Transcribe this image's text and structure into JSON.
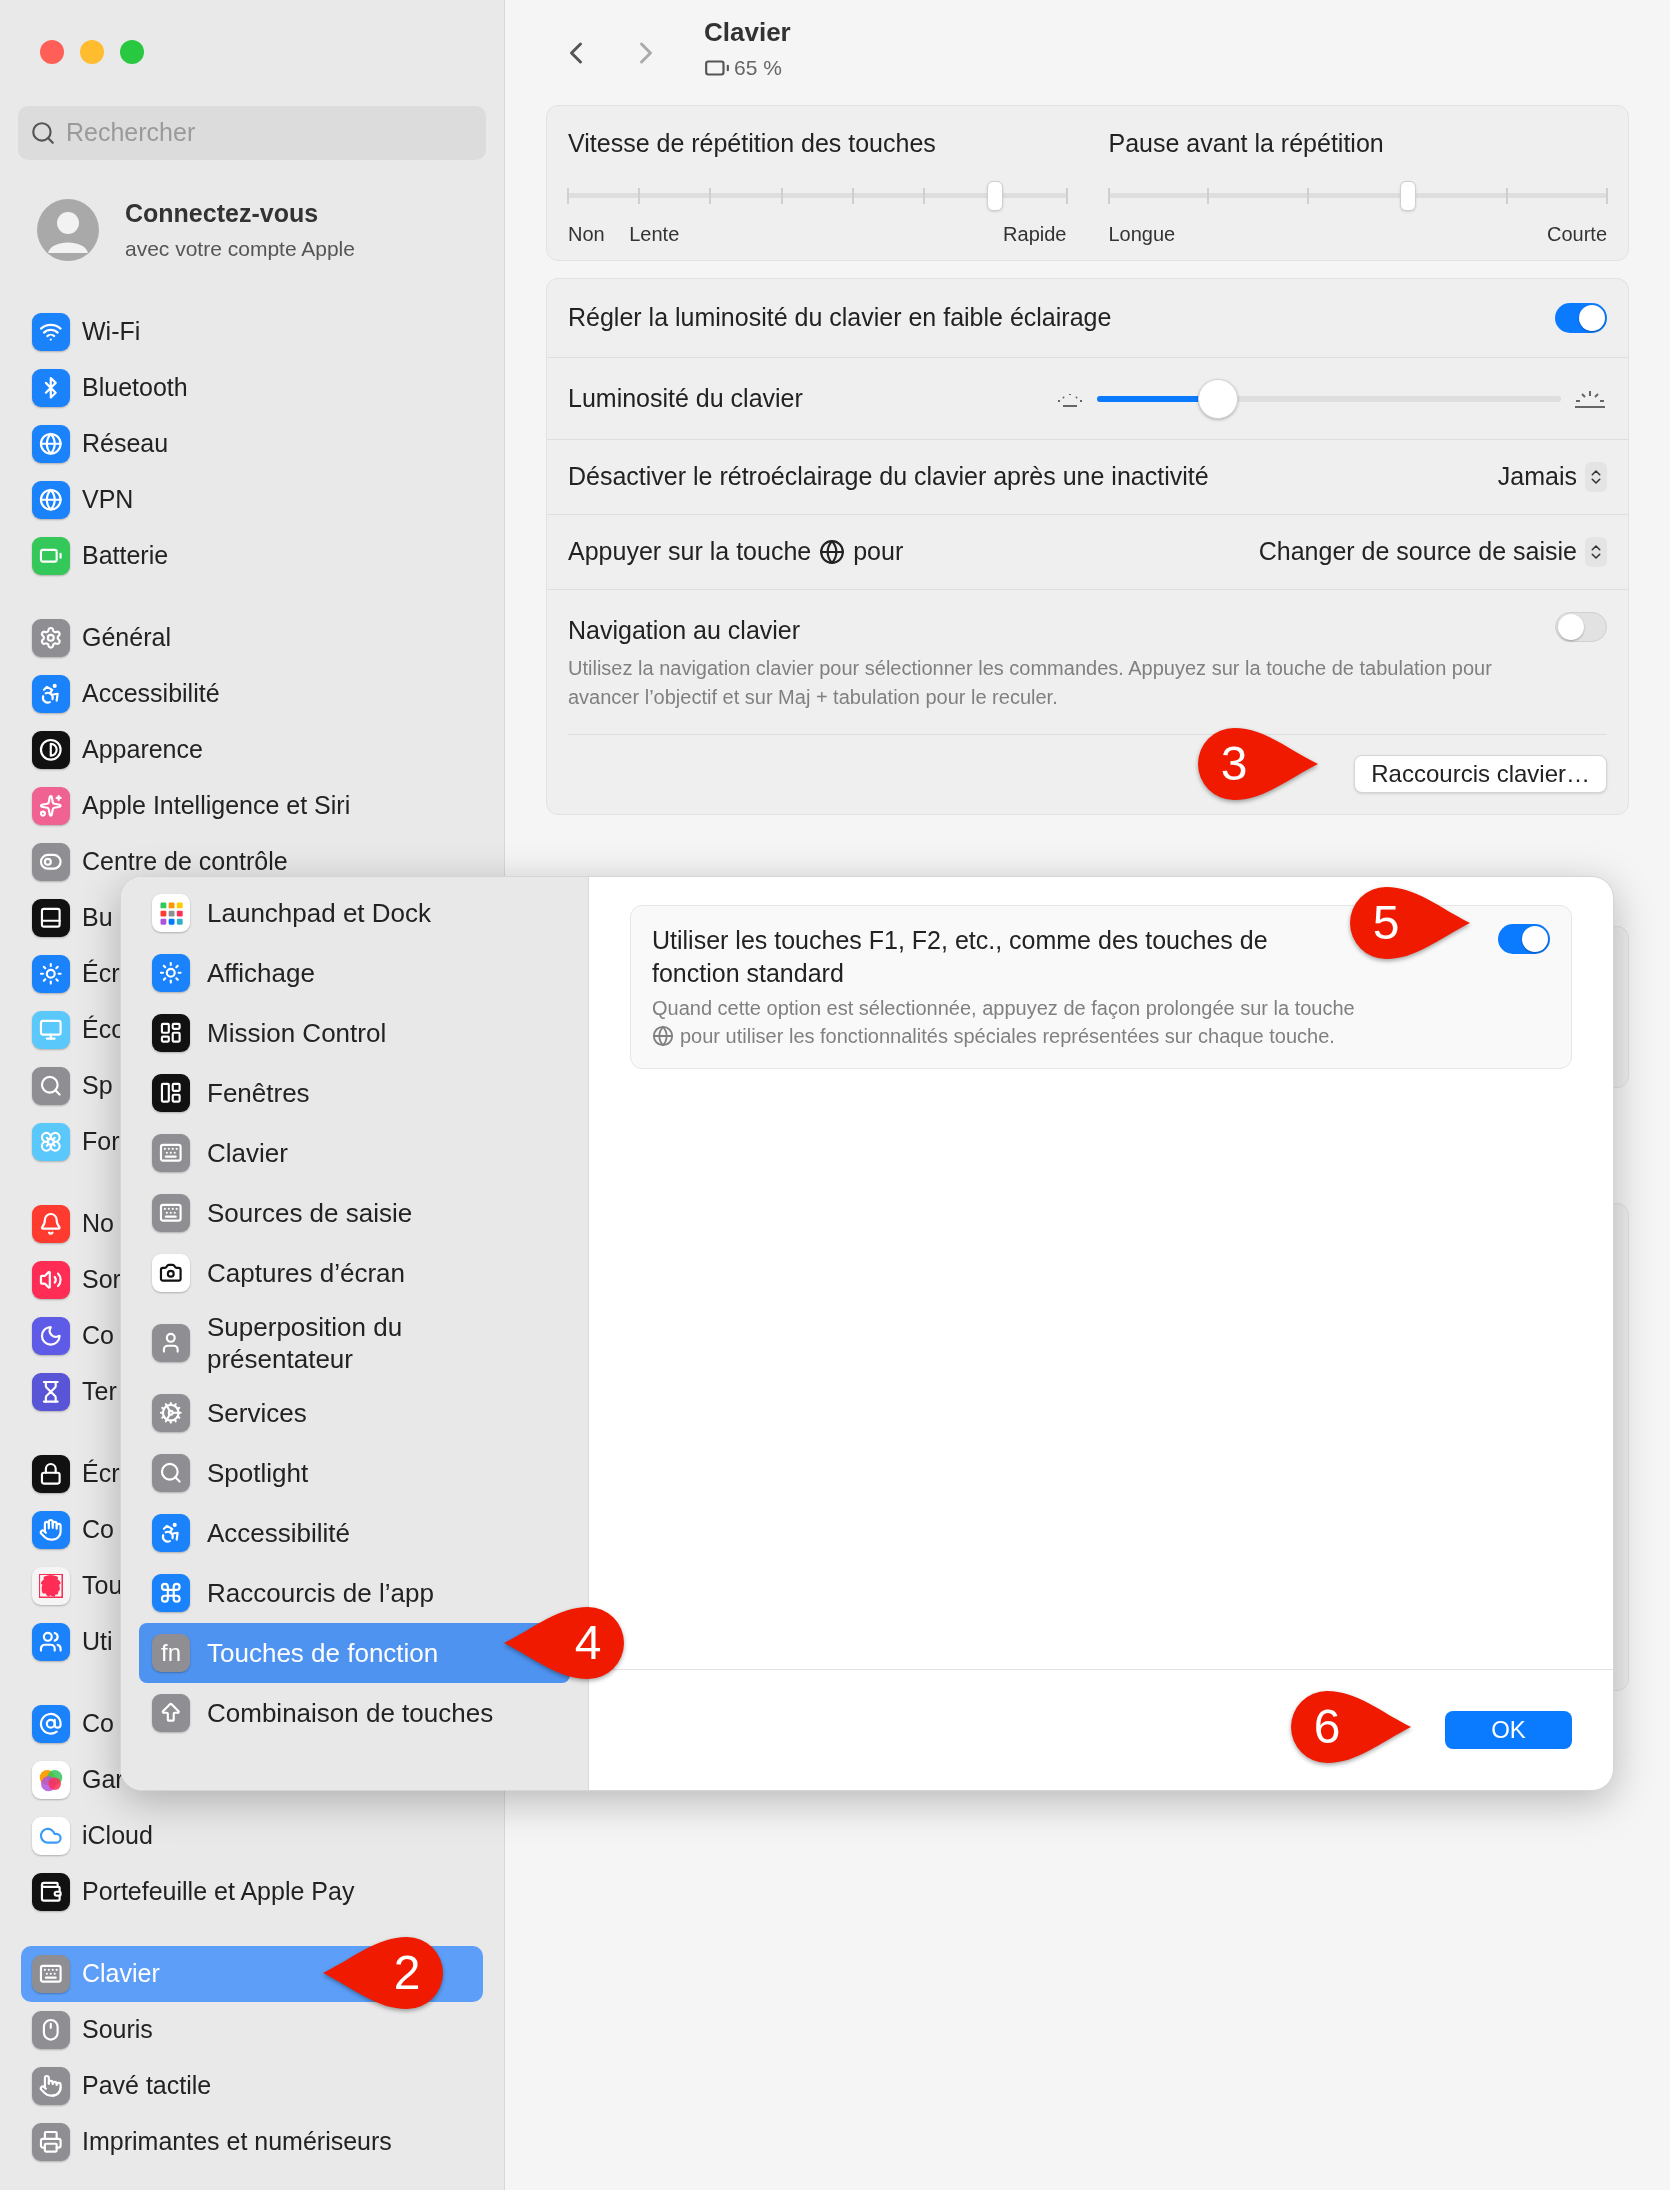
{
  "sidebar": {
    "search": {
      "placeholder": "Rechercher"
    },
    "account": {
      "title": "Connectez-vous",
      "subtitle": "avec votre compte Apple"
    },
    "groups": [
      {
        "items": [
          {
            "label": "Wi-Fi",
            "selected": false
          },
          {
            "label": "Bluetooth",
            "selected": false
          },
          {
            "label": "Réseau",
            "selected": false
          },
          {
            "label": "VPN",
            "selected": false
          },
          {
            "label": "Batterie",
            "selected": false
          }
        ]
      },
      {
        "items": [
          {
            "label": "Général",
            "selected": false
          },
          {
            "label": "Accessibilité",
            "selected": false
          },
          {
            "label": "Apparence",
            "selected": false
          },
          {
            "label": "Apple Intelligence et Siri",
            "selected": false
          },
          {
            "label": "Centre de contrôle",
            "selected": false
          },
          {
            "label": "Bu",
            "selected": false
          },
          {
            "label": "Écr",
            "selected": false
          },
          {
            "label": "Éco",
            "selected": false
          },
          {
            "label": "Sp",
            "selected": false
          },
          {
            "label": "For",
            "selected": false
          }
        ]
      },
      {
        "items": [
          {
            "label": "No",
            "selected": false
          },
          {
            "label": "Sor",
            "selected": false
          },
          {
            "label": "Co",
            "selected": false
          },
          {
            "label": "Ter",
            "selected": false
          }
        ]
      },
      {
        "items": [
          {
            "label": "Écr",
            "selected": false
          },
          {
            "label": "Co",
            "selected": false
          },
          {
            "label": "Tou",
            "selected": false
          },
          {
            "label": "Uti",
            "selected": false
          }
        ]
      },
      {
        "items": [
          {
            "label": "Co",
            "selected": false
          },
          {
            "label": "Gar",
            "selected": false
          },
          {
            "label": "iCloud",
            "selected": false
          },
          {
            "label": "Portefeuille et Apple Pay",
            "selected": false
          }
        ]
      },
      {
        "items": [
          {
            "label": "Clavier",
            "selected": true
          },
          {
            "label": "Souris",
            "selected": false
          },
          {
            "label": "Pavé tactile",
            "selected": false
          },
          {
            "label": "Imprimantes et numériseurs",
            "selected": false
          }
        ]
      }
    ]
  },
  "header": {
    "title": "Clavier",
    "battery": "65 %"
  },
  "repeat_card": {
    "sliders": [
      {
        "title": "Vitesse de répétition des touches",
        "level": 0.857,
        "labels": [
          "Non",
          "Lente",
          "Rapide"
        ]
      },
      {
        "title": "Pause avant la répétition",
        "level": 0.6,
        "labels": [
          "Longue",
          "Courte"
        ]
      }
    ]
  },
  "settings_card": {
    "rows": [
      {
        "kind": "toggle",
        "label": "Régler la luminosité du clavier en faible éclairage",
        "on": true
      },
      {
        "kind": "slider",
        "label": "Luminosité du clavier",
        "level": 0.26
      },
      {
        "kind": "popup",
        "label": "Désactiver le rétroéclairage du clavier après une inactivité",
        "value": "Jamais"
      },
      {
        "kind": "globe-popup",
        "label": "Appuyer sur la touche",
        "label_after": "pour",
        "value": "Changer de source de saisie"
      },
      {
        "kind": "toggle",
        "label": "Navigation au clavier",
        "description": "Utilisez la navigation clavier pour sélectionner les commandes. Appuyez sur la touche de tabulation pour avancer l’objectif et sur Maj + tabulation pour le reculer.",
        "on": false
      }
    ],
    "button": "Raccourcis clavier…"
  },
  "sheet": {
    "items": [
      {
        "label": "Launchpad et Dock",
        "selected": false
      },
      {
        "label": "Affichage",
        "selected": false
      },
      {
        "label": "Mission Control",
        "selected": false
      },
      {
        "label": "Fenêtres",
        "selected": false
      },
      {
        "label": "Clavier",
        "selected": false
      },
      {
        "label": "Sources de saisie",
        "selected": false
      },
      {
        "label": "Captures d’écran",
        "selected": false
      },
      {
        "label": "Superposition du présentateur",
        "selected": false
      },
      {
        "label": "Services",
        "selected": false
      },
      {
        "label": "Spotlight",
        "selected": false
      },
      {
        "label": "Accessibilité",
        "selected": false
      },
      {
        "label": "Raccourcis de l’app",
        "selected": false
      },
      {
        "label": "Touches de fonction",
        "selected": true,
        "icon_label": "fn"
      },
      {
        "label": "Combinaison de touches",
        "selected": false
      }
    ],
    "option": {
      "title": "Utiliser les touches F1, F2, etc., comme des touches de fonction standard",
      "description": "Quand cette option est sélectionnée, appuyez de façon prolongée sur la touche",
      "description_after": "pour utiliser les fonctionnalités spéciales représentées sur chaque touche.",
      "on": true
    },
    "ok_button": "OK"
  },
  "callouts": [
    {
      "number": "2",
      "kind": "left"
    },
    {
      "number": "3",
      "kind": "right"
    },
    {
      "number": "4",
      "kind": "left"
    },
    {
      "number": "5",
      "kind": "right"
    },
    {
      "number": "6",
      "kind": "right"
    }
  ]
}
